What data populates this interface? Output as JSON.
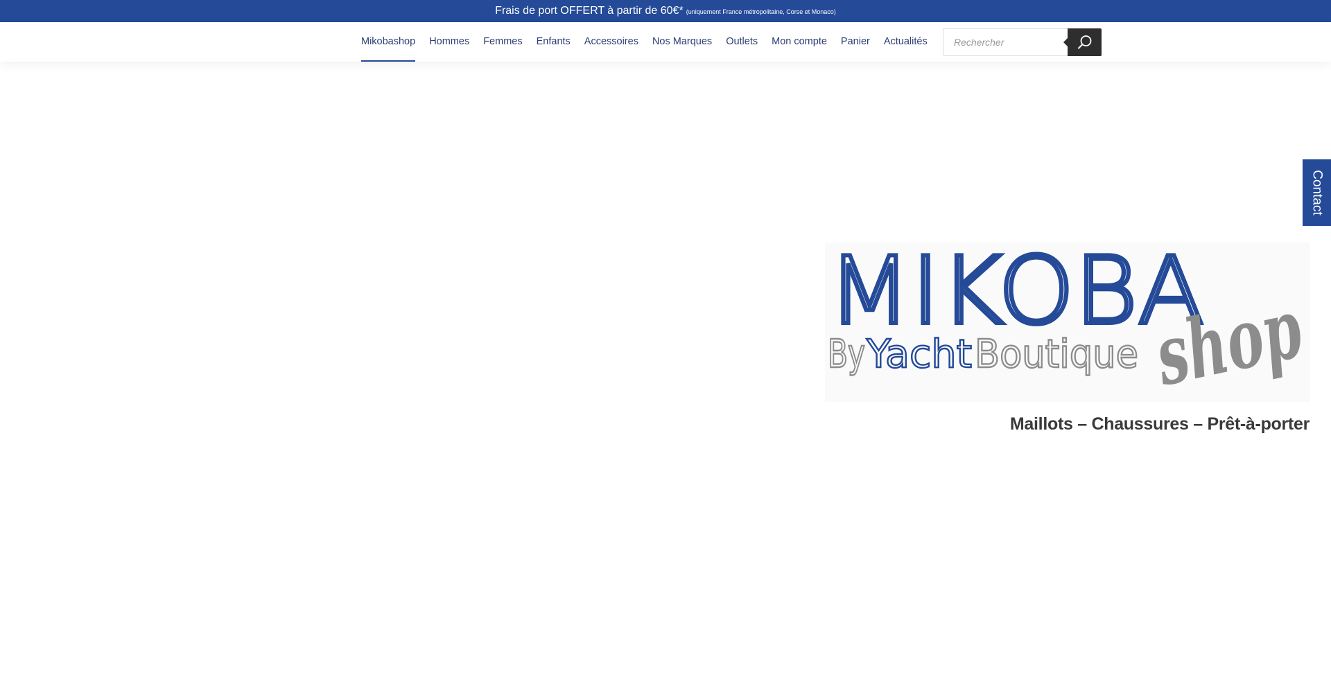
{
  "announcement": {
    "main": "Frais de port OFFERT à partir de 60€*",
    "note": "(uniquement France métropolitaine, Corse et Monaco)"
  },
  "nav": {
    "items": [
      {
        "label": "Mikobashop",
        "active": true
      },
      {
        "label": "Hommes"
      },
      {
        "label": "Femmes"
      },
      {
        "label": "Enfants"
      },
      {
        "label": "Accessoires"
      },
      {
        "label": "Nos Marques"
      },
      {
        "label": "Outlets"
      },
      {
        "label": "Mon compte"
      },
      {
        "label": "Panier"
      },
      {
        "label": "Actualités"
      }
    ],
    "search": {
      "placeholder": "Rechercher",
      "value": ""
    }
  },
  "contact_tab": {
    "label": "Contact"
  },
  "hero": {
    "logo": {
      "main": "MIKOBA",
      "by": "By",
      "yacht": "Yacht",
      "boutique": "Boutique",
      "script": "shop"
    },
    "tagline": "Maillots – Chaussures – Prêt-à-porter"
  },
  "colors": {
    "brand_blue": "#244a98",
    "nav_text": "#2b3d73",
    "search_button": "#2e2e2e",
    "logo_gray": "#8c8c8c"
  }
}
